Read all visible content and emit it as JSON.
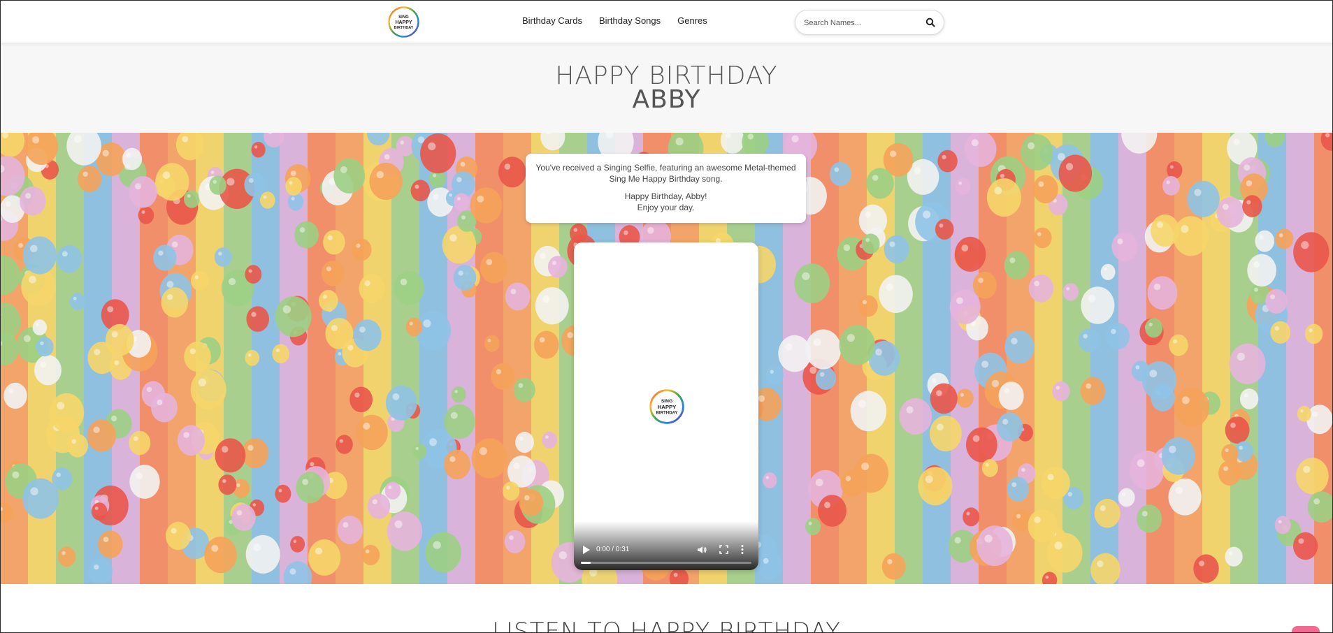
{
  "header": {
    "logo_label": "Sing Happy Birthday",
    "nav": [
      "Birthday Cards",
      "Birthday Songs",
      "Genres"
    ],
    "search_placeholder": "Search Names..."
  },
  "title": {
    "line1": "HAPPY BIRTHDAY",
    "line2": "ABBY"
  },
  "message": {
    "line1": "You've received a Singing Selfie, featuring an awesome Metal-themed",
    "line2": "Sing Me Happy Birthday song.",
    "line3": "Happy Birthday, Abby!",
    "line4": "Enjoy your day."
  },
  "video": {
    "time": "0:00 / 0:31",
    "progress_fraction": 0.0
  },
  "bottom": {
    "heading": "LISTEN TO HAPPY BIRTHDAY"
  },
  "colors": {
    "stripes": [
      "#f3a46a",
      "#f1d36e",
      "#a9cf8e",
      "#8fc0e0",
      "#d9b3d9",
      "#f08f6a"
    ],
    "accent": "#f06b8f"
  },
  "icons": [
    "logo-icon",
    "search-icon",
    "play-icon",
    "volume-icon",
    "fullscreen-icon",
    "more-icon"
  ]
}
